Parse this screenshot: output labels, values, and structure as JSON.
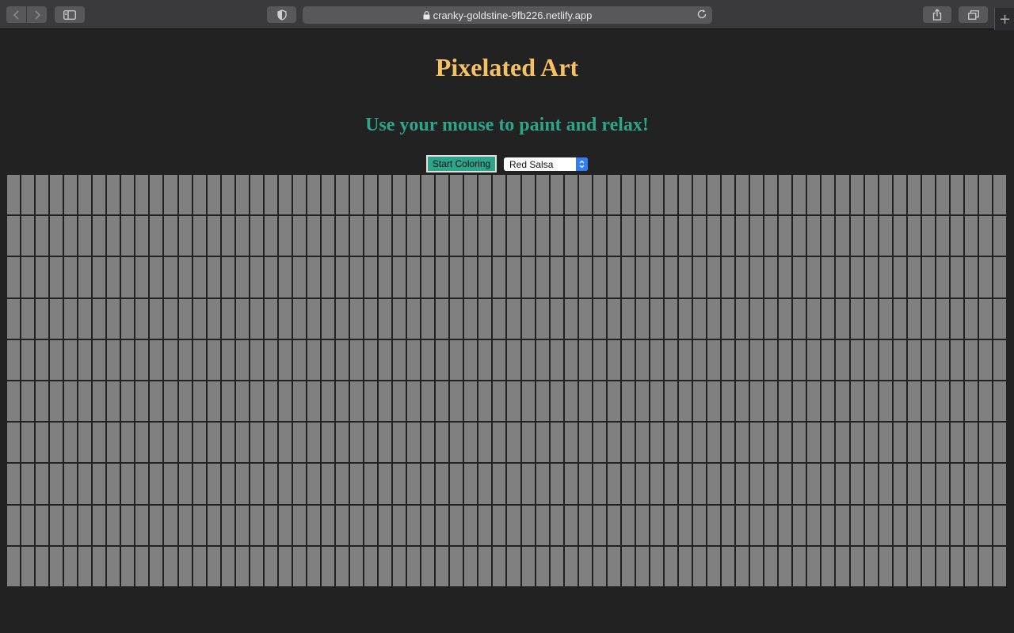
{
  "browser": {
    "url": "cranky-goldstine-9fb226.netlify.app"
  },
  "page": {
    "title": "Pixelated Art",
    "subtitle": "Use your mouse to paint and relax!",
    "start_button": "Start Coloring",
    "color_select": {
      "selected": "Red Salsa"
    }
  },
  "grid": {
    "rows": 10,
    "columns": 70,
    "cell_color": "#808080"
  },
  "colors": {
    "background": "#222222",
    "title": "#f6c066",
    "accent": "#2ea58a"
  }
}
